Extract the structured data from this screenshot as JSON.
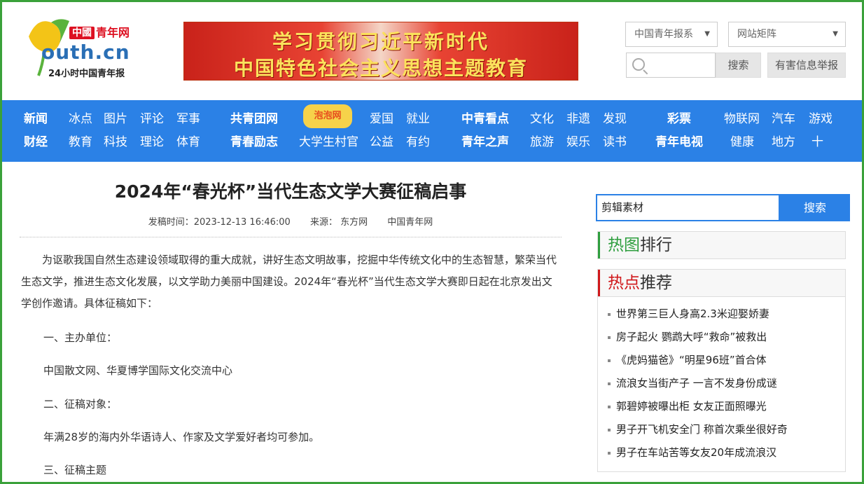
{
  "header": {
    "logo_badge": "中國",
    "logo_name": "青年网",
    "logo_domain": "outh.cn",
    "logo_tagline": "24小时中国青年报",
    "banner_line1": "学习贯彻习近平新时代",
    "banner_line2": "中国特色社会主义思想主题教育",
    "select1": "中国青年报系",
    "select2": "网站矩阵",
    "search_button": "搜索",
    "report_button": "有害信息举报"
  },
  "nav": {
    "row1": [
      "新闻",
      "冰点",
      "图片",
      "评论",
      "军事",
      "共青团网",
      "爱国",
      "就业",
      "中青看点",
      "文化",
      "非遗",
      "发现",
      "彩票",
      "物联网",
      "汽车",
      "游戏"
    ],
    "row2": [
      "财经",
      "教育",
      "科技",
      "理论",
      "体育",
      "青春励志",
      "大学生村官",
      "公益",
      "有约",
      "青年之声",
      "旅游",
      "娱乐",
      "读书",
      "青年电视",
      "健康",
      "地方",
      "十"
    ],
    "emblem": "泡泡网"
  },
  "article": {
    "title": "2024年“春光杯”当代生态文学大赛征稿启事",
    "meta_time": "发稿时间：2023-12-13 16:46:00",
    "meta_source": "来源： 东方网",
    "meta_site": "中国青年网",
    "p1": "为讴歌我国自然生态建设领域取得的重大成就，讲好生态文明故事，挖掘中华传统文化中的生态智慧，繁荣当代生态文学，推进生态文化发展，以文学助力美丽中国建设。2024年“春光杯”当代生态文学大赛即日起在北京发出文学创作邀请。具体征稿如下：",
    "h1": "一、主办单位：",
    "l1": "中国散文网、华夏博学国际文化交流中心",
    "h2": "二、征稿对象：",
    "l2": "年满28岁的海内外华语诗人、作家及文学爱好者均可参加。",
    "h3": "三、征稿主题"
  },
  "sidebar": {
    "search_value": "剪辑素材",
    "search_button": "搜索",
    "box1_accent": "热图",
    "box1_rest": "排行",
    "box2_accent": "热点",
    "box2_rest": "推荐",
    "hot_items": [
      "世界第三巨人身高2.3米迎娶娇妻",
      "房子起火 鹦鹉大呼“救命”被救出",
      "《虎妈猫爸》“明星96班”首合体",
      "流浪女当街产子 一言不发身份成谜",
      "郭碧婷被曝出柜 女友正面照曝光",
      "男子开飞机安全门 称首次乘坐很好奇",
      "男子在车站苦等女友20年成流浪汉"
    ]
  },
  "colors": {
    "accent": "#2b81e6",
    "frame": "#3aa13a",
    "hot_red": "#d0181b",
    "hot_green": "#2e9e3e"
  }
}
